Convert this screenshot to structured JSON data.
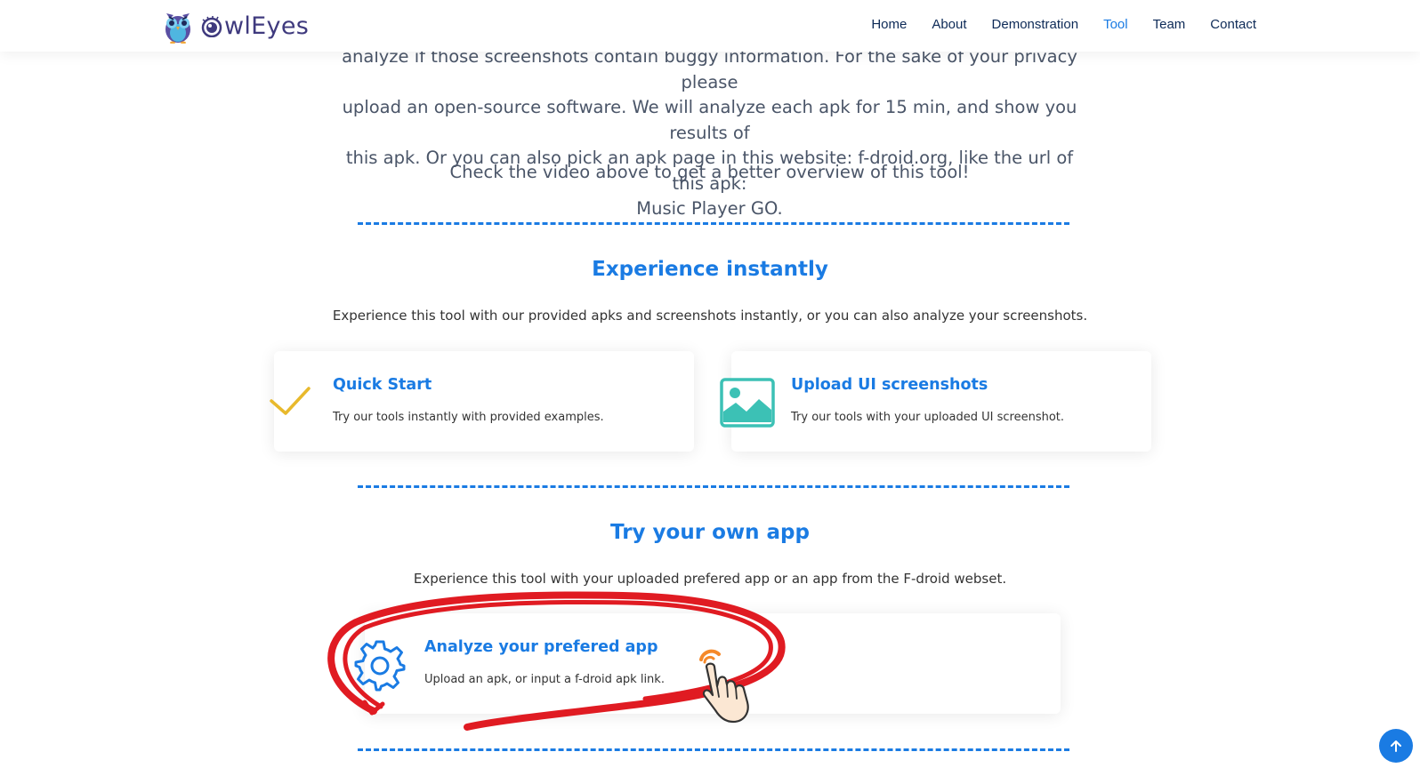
{
  "brand": {
    "name": "wlEyes"
  },
  "nav": {
    "items": [
      {
        "label": "Home"
      },
      {
        "label": "About"
      },
      {
        "label": "Demonstration"
      },
      {
        "label": "Tool",
        "active": true
      },
      {
        "label": "Team"
      },
      {
        "label": "Contact"
      }
    ]
  },
  "intro": {
    "lines": [
      "analyze if those screenshots contain buggy information. For the sake of your privacy please",
      "upload an open-source software. We will analyze each apk for 15 min, and show you results of",
      "this apk. Or you can also pick an apk page in this website: f-droid.org, like the url of this apk:",
      "Music Player GO."
    ],
    "check_video": "Check the video above to get a better overview of this tool!"
  },
  "experience": {
    "title": "Experience instantly",
    "description": "Experience this tool with our provided apks and screenshots instantly, or you can also analyze your screenshots.",
    "cards": [
      {
        "icon": "checkmark-icon",
        "title": "Quick Start",
        "description": "Try our tools instantly with provided examples."
      },
      {
        "icon": "image-icon",
        "title": "Upload UI screenshots",
        "description": "Try our tools with your uploaded UI screenshot."
      }
    ]
  },
  "own_app": {
    "title": "Try your own app",
    "description": "Experience this tool with your uploaded prefered app or an app from the F-droid webset.",
    "card": {
      "icon": "gear-icon",
      "title": "Analyze your prefered app",
      "description": "Upload an apk, or input a f-droid apk link."
    }
  },
  "colors": {
    "accent": "#1a7be3",
    "nav_text": "#0d2a57",
    "check": "#e8b92c",
    "image_icon": "#3cc1b5",
    "scribble": "#e01b22"
  },
  "icons": {
    "back_to_top": "arrow-up-icon",
    "pointer": "hand-pointer-icon"
  }
}
